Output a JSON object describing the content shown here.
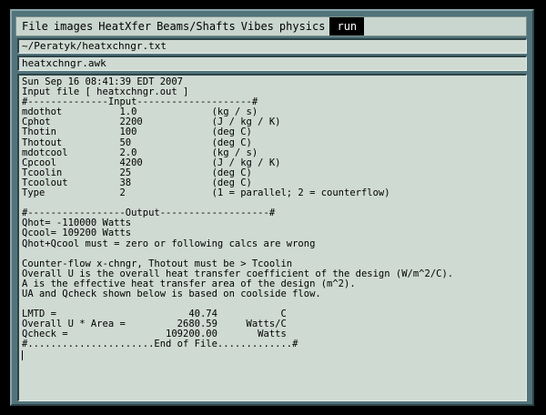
{
  "menu": {
    "items": [
      "File",
      "images",
      "HeatXfer",
      "Beams/Shafts",
      "Vibes",
      "physics"
    ],
    "run_label": "run"
  },
  "fields": {
    "path": "~/Peratyk/heatxchngr.txt",
    "script": "heatxchngr.awk"
  },
  "output": {
    "lines": [
      "Sun Sep 16 08:41:39 EDT 2007",
      "Input file [ heatxchngr.out ]",
      "#--------------Input--------------------#",
      "mdothot          1.0             (kg / s)",
      "Cphot            2200            (J / kg / K)",
      "Thotin           100             (deg C)",
      "Thotout          50              (deg C)",
      "mdotcool         2.0             (kg / s)",
      "Cpcool           4200            (J / kg / K)",
      "Tcoolin          25              (deg C)",
      "Tcoolout         38              (deg C)",
      "Type             2               (1 = parallel; 2 = counterflow)",
      "",
      "#-----------------Output-------------------#",
      "Qhot= -110000 Watts",
      "Qcool= 109200 Watts",
      "Qhot+Qcool must = zero or following calcs are wrong",
      "",
      "Counter-flow x-chngr, Thotout must be > Tcoolin",
      "Overall U is the overall heat transfer coefficient of the design (W/m^2/C).",
      "A is the effective heat transfer area of the design (m^2).",
      "UA and Qcheck shown below is based on coolside flow.",
      "",
      "LMTD =                       40.74           C",
      "Overall U * Area =         2680.59     Watts/C",
      "Qcheck =                 109200.00       Watts",
      "#......................End of File.............#"
    ]
  }
}
